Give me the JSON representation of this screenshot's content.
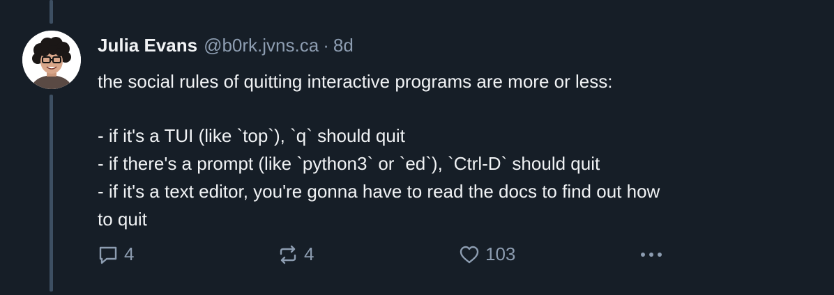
{
  "author": {
    "display_name": "Julia Evans",
    "handle": "@b0rk.jvns.ca",
    "separator": "·",
    "time_ago": "8d",
    "avatar": "avatar-photo"
  },
  "post": {
    "lines": [
      "the social rules of quitting interactive programs are more or less:",
      "",
      "- if it's a TUI (like `top`), `q` should quit",
      "- if there's a prompt (like `python3` or `ed`), `Ctrl-D` should quit",
      "- if it's a text editor, you're gonna have to read the docs to find out how",
      "to quit"
    ]
  },
  "actions": {
    "reply_count": "4",
    "repost_count": "4",
    "like_count": "103",
    "icons": [
      "reply-icon",
      "repost-icon",
      "heart-icon",
      "more-icon"
    ]
  },
  "colors": {
    "background": "#161e27",
    "text": "#f1f3f5",
    "muted": "#8d9db1",
    "thread_line": "#3d4f62"
  }
}
